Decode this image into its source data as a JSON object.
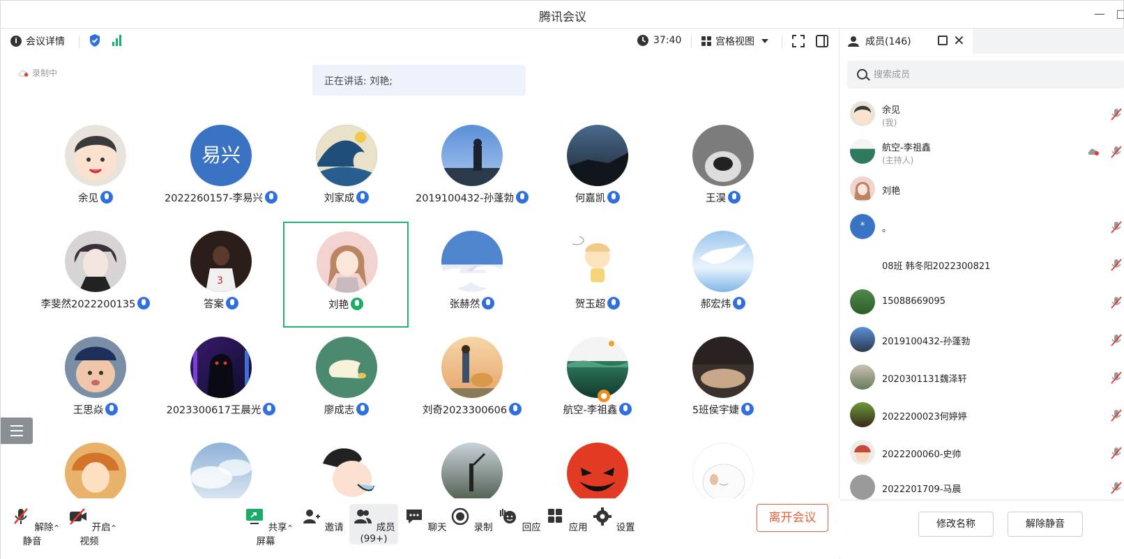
{
  "window": {
    "title": "腾讯会议"
  },
  "infobar": {
    "detail_label": "会议详情",
    "timer": "37:40",
    "view_label": "宫格视图"
  },
  "recording_label": "录制中",
  "speaking": "正在讲话: 刘艳;",
  "participants": [
    {
      "name": "余见",
      "mic": "blue"
    },
    {
      "name": "2022260157-李易兴",
      "mic": "blue",
      "avatar_text": "易兴"
    },
    {
      "name": "刘家成",
      "mic": "blue"
    },
    {
      "name": "2019100432-孙蓬勃",
      "mic": "blue"
    },
    {
      "name": "何嘉凯",
      "mic": "blue"
    },
    {
      "name": "王淏",
      "mic": "blue"
    },
    {
      "name": "李斐然2022200135",
      "mic": "blue"
    },
    {
      "name": "答案",
      "mic": "blue"
    },
    {
      "name": "刘艳",
      "mic": "green",
      "active": true
    },
    {
      "name": "张赫然",
      "mic": "blue"
    },
    {
      "name": "贺玉超",
      "mic": "blue"
    },
    {
      "name": "郝宏炜",
      "mic": "blue"
    },
    {
      "name": "王思焱",
      "mic": "blue"
    },
    {
      "name": "2023300617王晨光",
      "mic": "blue"
    },
    {
      "name": "廖成志",
      "mic": "blue"
    },
    {
      "name": "刘奇2023300606",
      "mic": "blue"
    },
    {
      "name": "航空-李祖鑫",
      "mic": "blue",
      "host": true
    },
    {
      "name": "5班侯宇婕",
      "mic": "blue"
    }
  ],
  "toolbar": {
    "unmute": "解除静音",
    "video": "开启视频",
    "share": "共享屏幕",
    "invite": "邀请",
    "members": "成员(99+)",
    "chat": "聊天",
    "record": "录制",
    "playback": "回应",
    "apps": "应用",
    "settings": "设置",
    "leave": "离开会议"
  },
  "sidebar": {
    "tab_label": "成员(146)",
    "search_placeholder": "搜索成员",
    "members": [
      {
        "name": "余见",
        "sub": "(我)"
      },
      {
        "name": "航空-李祖鑫",
        "sub": "(主持人)"
      },
      {
        "name": "刘艳",
        "sub": ""
      },
      {
        "name": "。",
        "sub": "",
        "avatar_text": "*"
      },
      {
        "name": "08班 韩冬阳2022300821",
        "sub": ""
      },
      {
        "name": "15088669095",
        "sub": ""
      },
      {
        "name": "2019100432-孙蓬勃",
        "sub": ""
      },
      {
        "name": "2020301131魏泽轩",
        "sub": ""
      },
      {
        "name": "2022200023何婷婷",
        "sub": ""
      },
      {
        "name": "2022200060-史帅",
        "sub": ""
      },
      {
        "name": "2022201709-马晨",
        "sub": ""
      }
    ],
    "rename_button": "修改名称",
    "unmute_button": "解除静音"
  },
  "colors": {
    "accent_blue": "#2f6fde",
    "speaking_green": "#21b36c",
    "leave_red": "#e0603b"
  }
}
